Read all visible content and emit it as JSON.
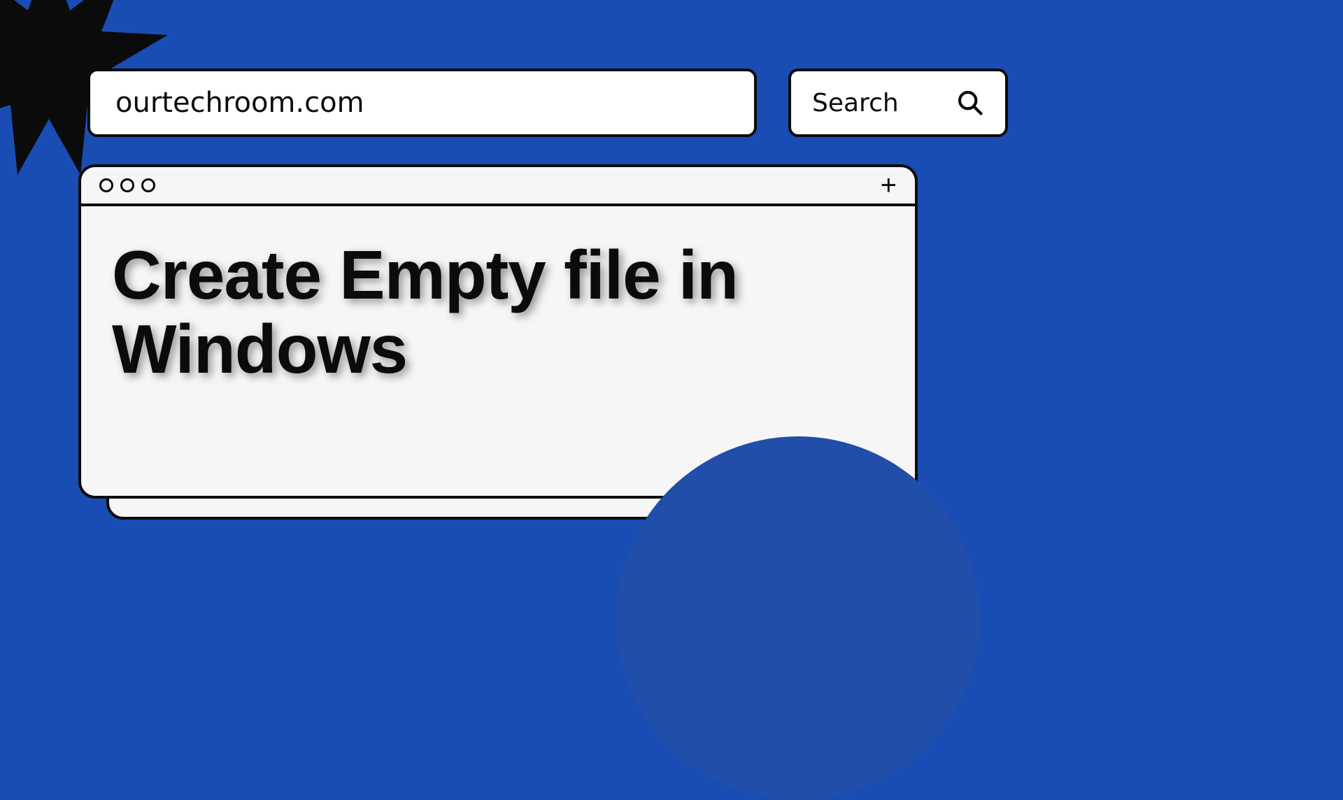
{
  "address_bar": {
    "text": "ourtechroom.com"
  },
  "search": {
    "label": "Search"
  },
  "headline": "Create Empty file in Windows",
  "colors": {
    "background": "#1a4db3",
    "accent_circle": "#204ea8",
    "window_bg": "#f6f6f6",
    "stroke": "#0b0b0b"
  }
}
